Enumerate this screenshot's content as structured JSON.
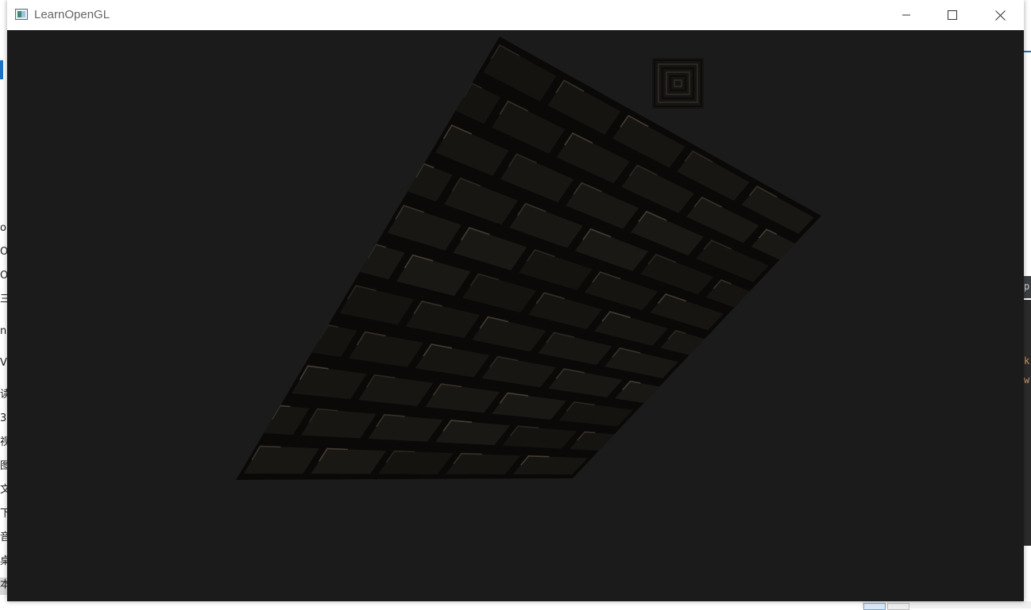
{
  "window": {
    "title": "LearnOpenGL",
    "controls": {
      "minimize": "minimize-icon",
      "maximize": "maximize-icon",
      "close": "close-icon"
    }
  },
  "viewport": {
    "clear_color": "#1b1b1b",
    "brick_base_color": "#151311",
    "mortar_color": "#0a0908",
    "highlight_color": "#7a6a55"
  },
  "background_fragments": {
    "left": [
      "o",
      "O",
      "O",
      "三",
      "n",
      "V",
      "读",
      "3",
      "视",
      "图",
      "文",
      "下",
      "音",
      "桌",
      "本"
    ],
    "right": [
      "p",
      "k",
      "w"
    ]
  }
}
